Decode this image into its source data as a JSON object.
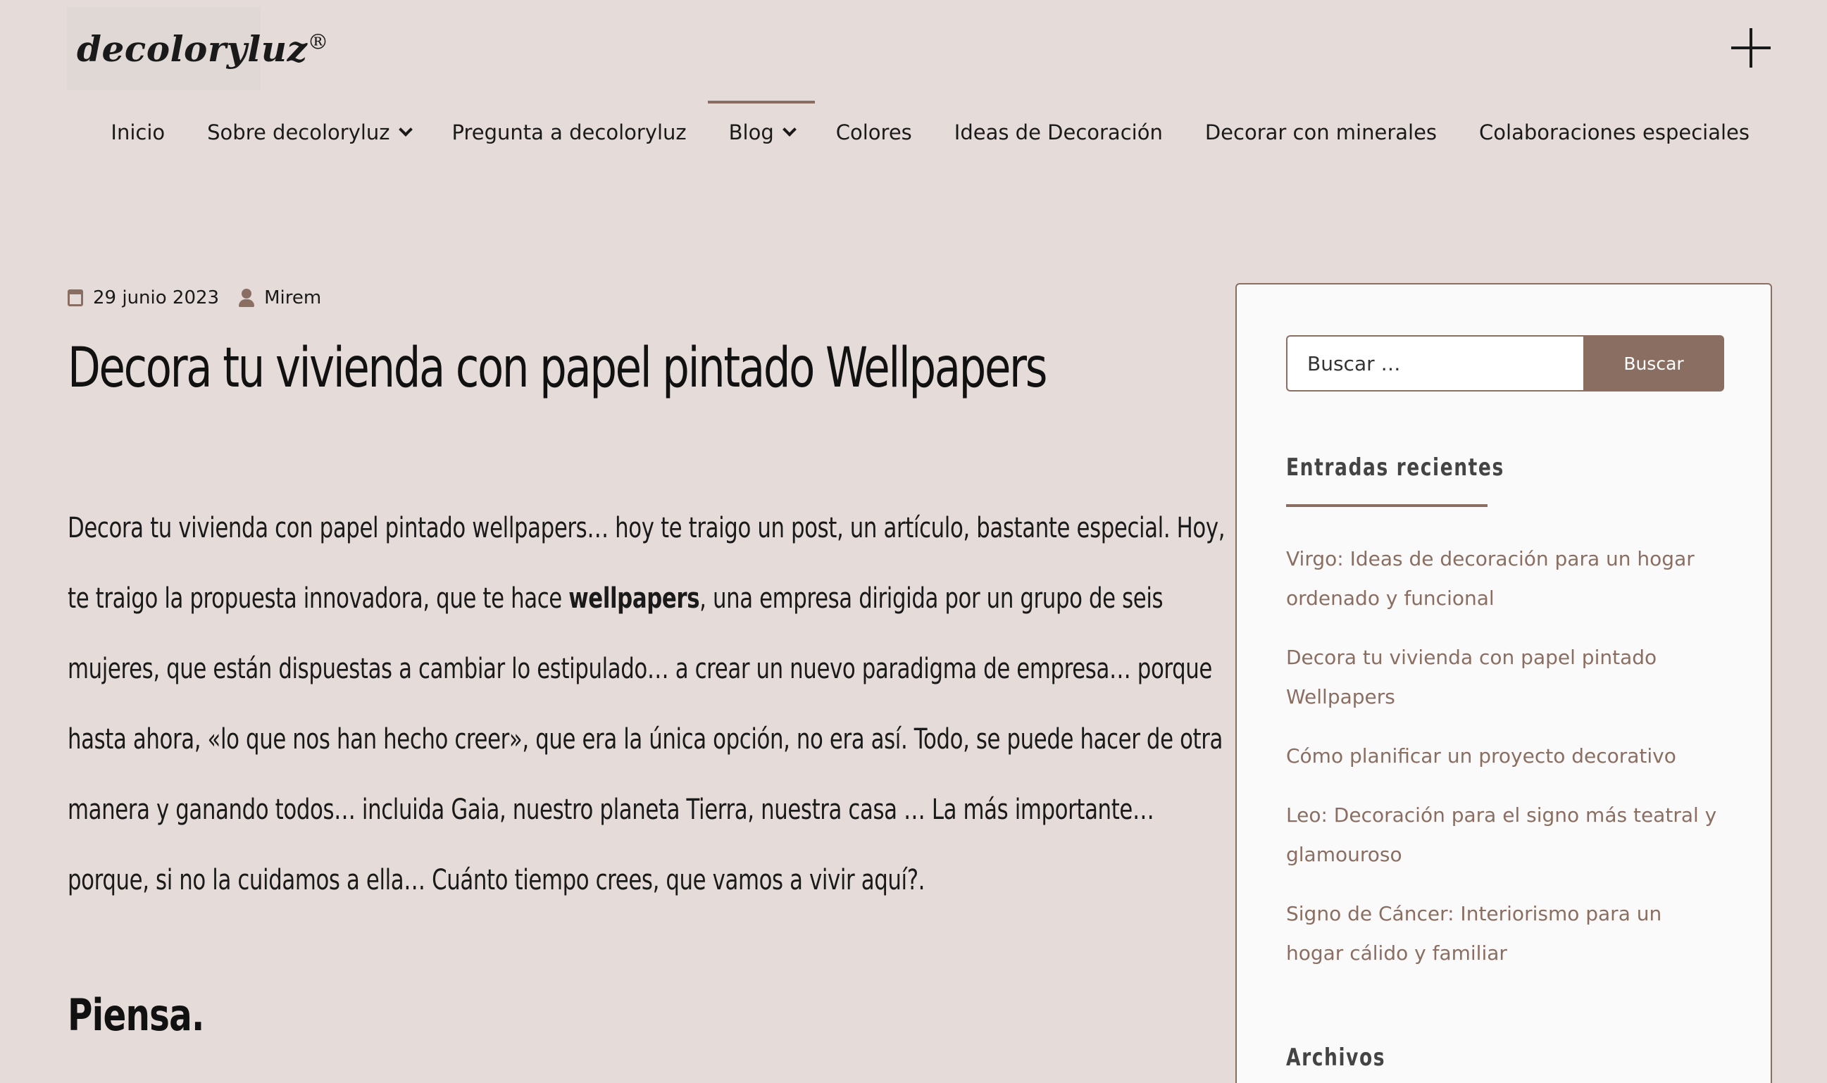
{
  "site": {
    "logo_text": "decoloryluz",
    "logo_mark": "®",
    "menu_toggle_icon": "plus-icon"
  },
  "nav": {
    "items": [
      {
        "label": "Inicio",
        "has_dropdown": false
      },
      {
        "label": "Sobre decoloryluz",
        "has_dropdown": true
      },
      {
        "label": "Pregunta a decoloryluz",
        "has_dropdown": false
      },
      {
        "label": "Blog",
        "has_dropdown": true,
        "active": true
      },
      {
        "label": "Colores",
        "has_dropdown": false
      },
      {
        "label": "Ideas de Decoración",
        "has_dropdown": false
      },
      {
        "label": "Decorar con minerales",
        "has_dropdown": false
      },
      {
        "label": "Colaboraciones especiales",
        "has_dropdown": false
      }
    ]
  },
  "post": {
    "date": "29 junio 2023",
    "author": "Mirem",
    "title": "Decora tu vivienda con papel pintado Wellpapers",
    "paragraph_part1": "Decora tu vivienda con papel pintado wellpapers… hoy te traigo un post, un artículo, bastante especial. Hoy, te traigo la propuesta innovadora, que te hace ",
    "paragraph_bold": "wellpapers",
    "paragraph_part2": ", una empresa dirigida por un grupo de seis mujeres, que están dispuestas a cambiar lo estipulado… a crear un nuevo paradigma de empresa… porque hasta ahora, «lo que nos han hecho creer», que era la única opción, no era así. Todo, se puede hacer de otra manera y ganando todos… incluida Gaia, nuestro planeta Tierra, nuestra casa … La más importante… porque, si no la cuidamos a ella… Cuánto tiempo crees, que vamos a vivir aquí?.",
    "subheading": "Piensa."
  },
  "sidebar": {
    "search_placeholder": "Buscar …",
    "search_button": "Buscar",
    "recent_title": "Entradas recientes",
    "recent_posts": [
      "Virgo: Ideas de decoración para un hogar ordenado y funcional",
      "Decora tu vivienda con papel pintado Wellpapers",
      "Cómo planificar un proyecto decorativo",
      "Leo: Decoración para el signo más teatral y glamouroso",
      "Signo de Cáncer: Interiorismo para un hogar cálido y familiar"
    ],
    "archives_title": "Archivos"
  },
  "colors": {
    "background": "#e5dcd9",
    "accent": "#8b6e62",
    "sidebar_bg": "#fafafa"
  }
}
